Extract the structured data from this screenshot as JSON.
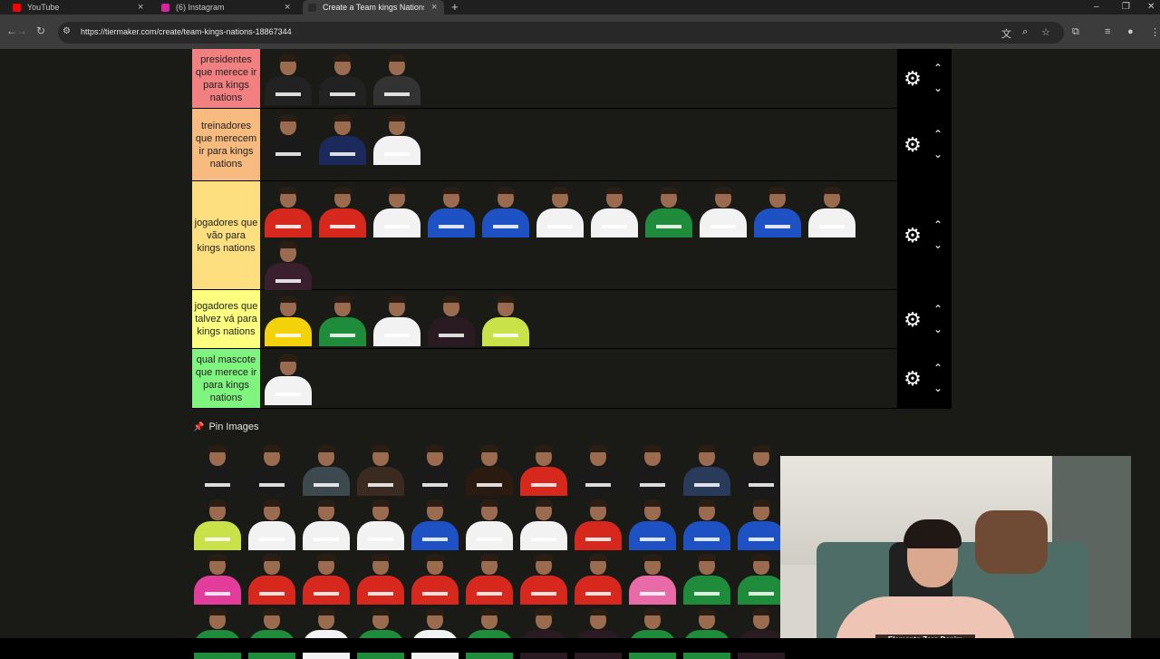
{
  "browser": {
    "tabs": [
      {
        "title": "YouTube",
        "favicon_color": "#ff0000"
      },
      {
        "title": "(6) Instagram",
        "favicon_color": "#d6249f"
      },
      {
        "title": "Create a Team kings Nations Ti",
        "favicon_color": "#2b2b2b"
      }
    ],
    "new_tab": "+",
    "url": "https://tiermaker.com/create/team-kings-nations-18867344",
    "controls": {
      "minimize": "–",
      "restore": "❐",
      "close": "✕"
    }
  },
  "tiers": [
    {
      "label": "presidentes que merece ir para kings nations",
      "color": "#f28080",
      "kits": [
        "#222222",
        "#222222",
        "#333333"
      ]
    },
    {
      "label": "treinadores que merecem ir para kings nations",
      "color": "#f8bb7f",
      "kits": [
        "#1a1a1a",
        "#1b2a5a",
        "#f2f2f2"
      ]
    },
    {
      "label": "jogadores que vão para kings nations",
      "color": "#fedf7f",
      "kits": [
        "#d7281e",
        "#d7281e",
        "#f2f2f2",
        "#1e52c4",
        "#1e52c4",
        "#f2f2f2",
        "#f2f2f2",
        "#1e8c3a",
        "#f2f2f2",
        "#1e52c4",
        "#f2f2f2",
        "#3a1f2e"
      ]
    },
    {
      "label": "jogadores que talvez vá para kings nations",
      "color": "#fefe7f",
      "kits": [
        "#f3d20a",
        "#1e8c3a",
        "#f2f2f2",
        "#2a1a22",
        "#c9e24a"
      ]
    },
    {
      "label": "qual mascote que merece ir para kings nations",
      "color": "#7ff57f",
      "kits": [
        "#f2f2f2"
      ]
    }
  ],
  "tier_controls": {
    "settings_icon": "gear-icon",
    "up_icon": "chevron-up-icon",
    "down_icon": "chevron-down-icon"
  },
  "pin_images": {
    "title": "Pin Images",
    "rows": [
      [
        "#1a1a1a",
        "#1a1a1a",
        "#3c4a50",
        "#3a2a20",
        "#1a1a1a",
        "#2a1a10",
        "#d7281e",
        "#1a1a1a",
        "#1a1a1a",
        "#2a3a5a",
        "#1a1a1a"
      ],
      [
        "#c9e24a",
        "#f2f2f2",
        "#f2f2f2",
        "#f2f2f2",
        "#1e52c4",
        "#f2f2f2",
        "#f2f2f2",
        "#d7281e",
        "#1e52c4",
        "#1e52c4",
        "#1e52c4"
      ],
      [
        "#e33d9c",
        "#d7281e",
        "#d7281e",
        "#d7281e",
        "#d7281e",
        "#d7281e",
        "#d7281e",
        "#d7281e",
        "#e86aa6",
        "#1e8c3a",
        "#1e8c3a"
      ],
      [
        "#1e8c3a",
        "#1e8c3a",
        "#f2f2f2",
        "#1e8c3a",
        "#f2f2f2",
        "#1e8c3a",
        "#2a1a22",
        "#2a1a22",
        "#1e8c3a",
        "#1e8c3a",
        "#2a1a22"
      ]
    ]
  },
  "webcam": {
    "shirt_text": "Elemento Zero Denim"
  }
}
